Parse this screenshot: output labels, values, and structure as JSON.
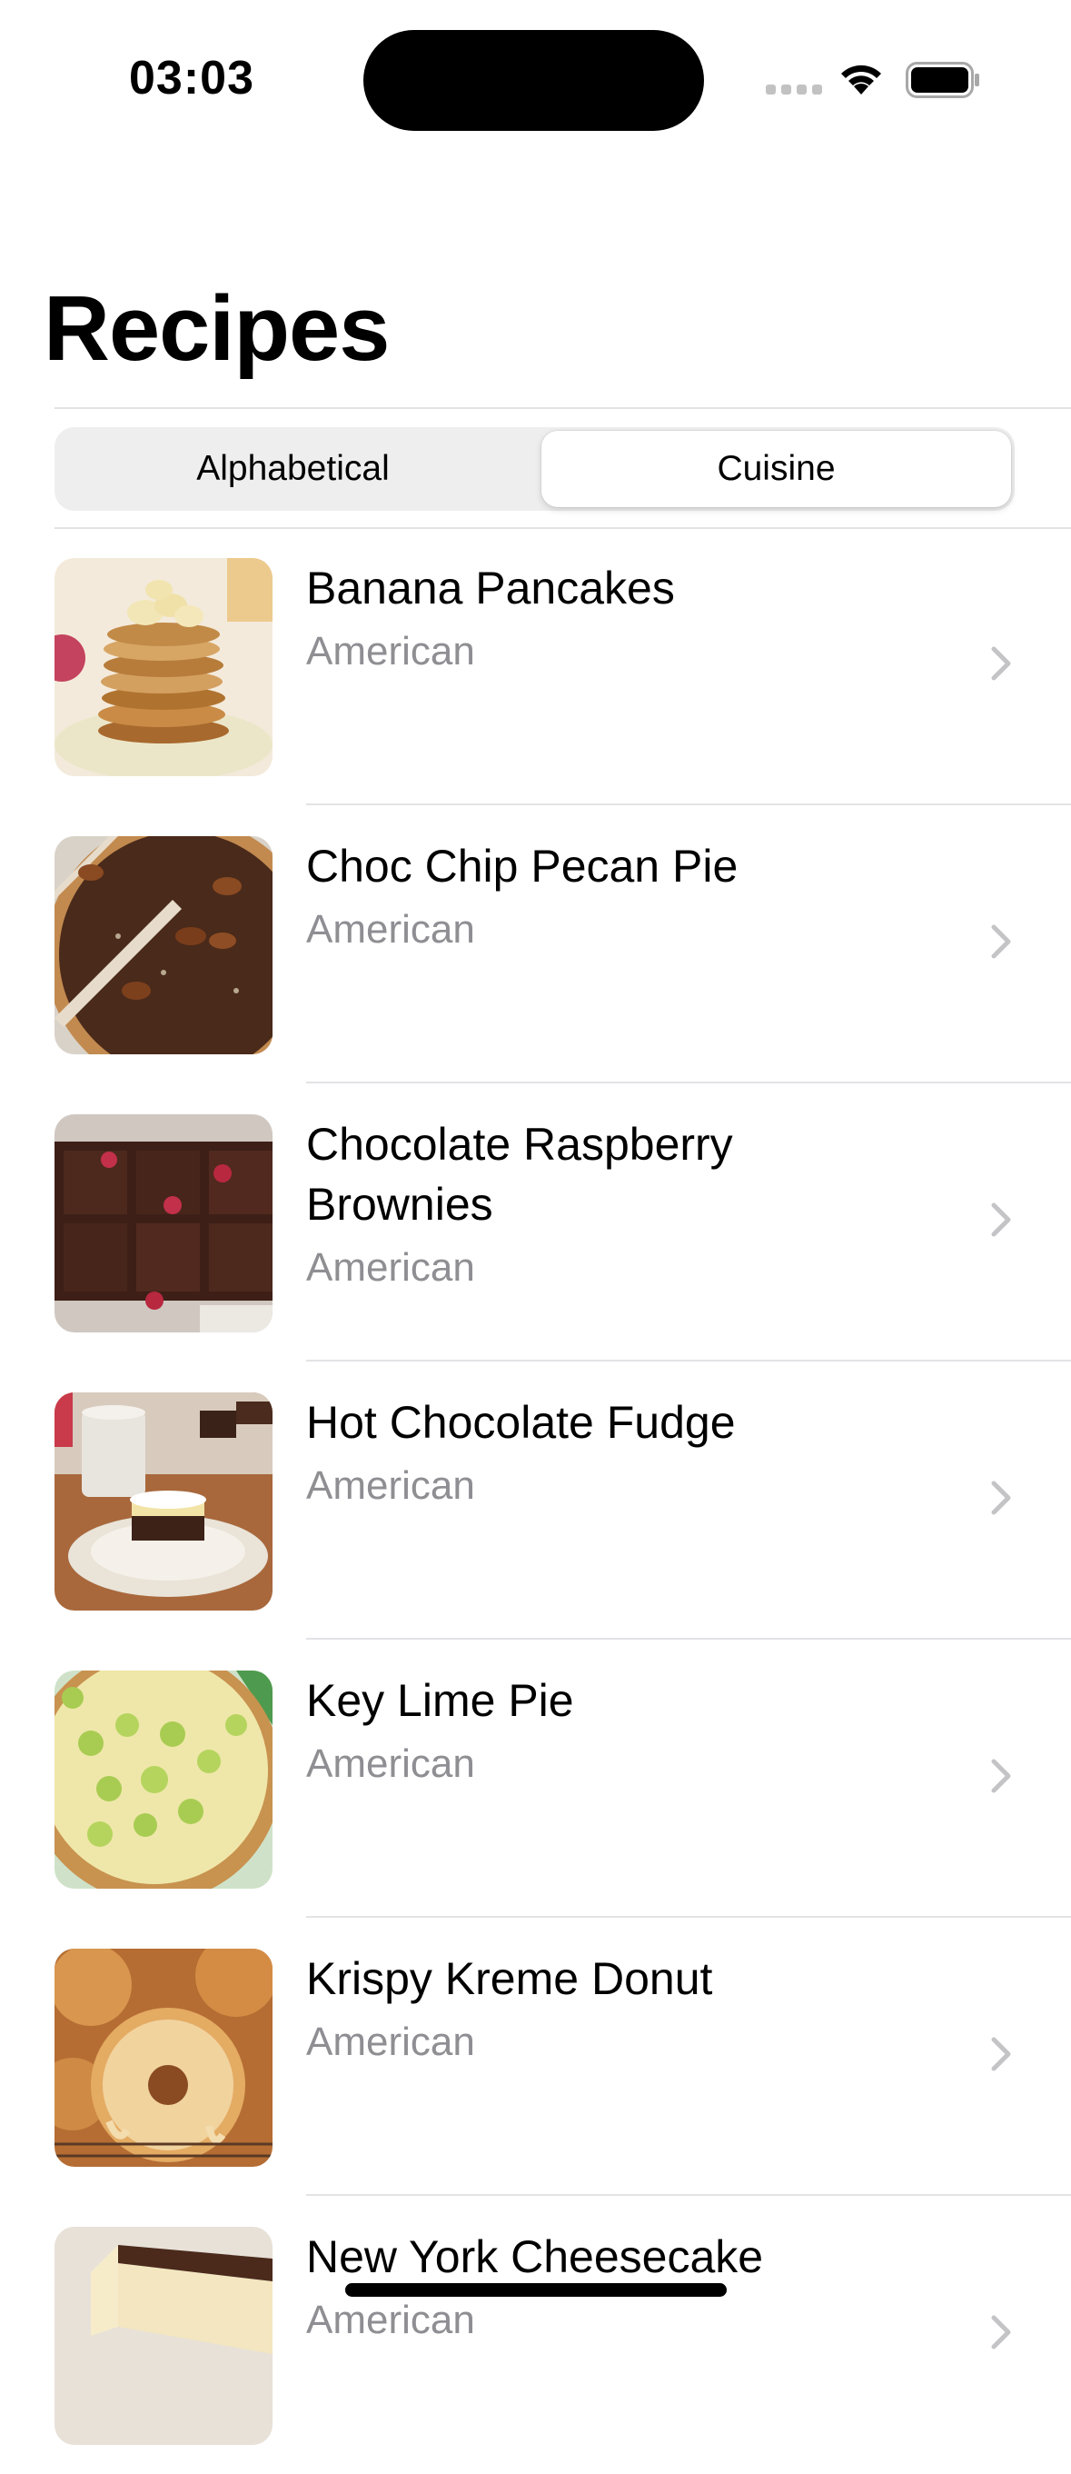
{
  "status_bar": {
    "time": "03:03"
  },
  "header": {
    "title": "Recipes"
  },
  "sort_control": {
    "options": [
      "Alphabetical",
      "Cuisine"
    ],
    "selected": "Cuisine"
  },
  "recipes": [
    {
      "name": "Banana Pancakes",
      "cuisine": "American",
      "image": "pancakes-photo"
    },
    {
      "name": "Choc Chip Pecan Pie",
      "cuisine": "American",
      "image": "pecan-pie-photo"
    },
    {
      "name": "Chocolate Raspberry Brownies",
      "cuisine": "American",
      "image": "brownies-photo"
    },
    {
      "name": "Hot Chocolate Fudge",
      "cuisine": "American",
      "image": "fudge-photo"
    },
    {
      "name": "Key Lime Pie",
      "cuisine": "American",
      "image": "key-lime-pie-photo"
    },
    {
      "name": "Krispy Kreme Donut",
      "cuisine": "American",
      "image": "donut-photo"
    },
    {
      "name": "New York Cheesecake",
      "cuisine": "American",
      "image": "cheesecake-photo"
    }
  ],
  "colors": {
    "secondary_text": "#8e8e93",
    "separator": "#e3e3e6",
    "segment_track": "#eeeeef"
  }
}
